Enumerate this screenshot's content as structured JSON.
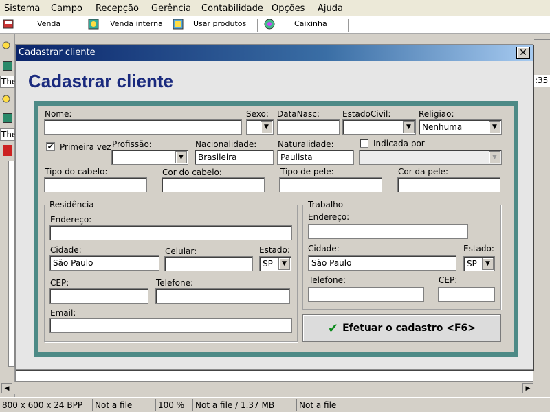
{
  "menubar": {
    "items": [
      "Sistema",
      "Campo",
      "Recepção",
      "Gerência",
      "Contabilidade",
      "Opções",
      "Ajuda"
    ]
  },
  "toolbar": {
    "buttons": [
      "Venda",
      "Venda interna",
      "Usar produtos",
      "Caixinha"
    ]
  },
  "background": {
    "fragments": [
      "The",
      "The",
      ":35"
    ]
  },
  "dialog": {
    "title": "Cadastrar cliente",
    "close_glyph": "✕",
    "heading": "Cadastrar cliente"
  },
  "form": {
    "nome_label": "Nome:",
    "nome_value": "",
    "sexo_label": "Sexo:",
    "sexo_value": "",
    "datanasc_label": "DataNasc:",
    "datanasc_value": "",
    "estadocivil_label": "EstadoCivil:",
    "estadocivil_value": "",
    "religiao_label": "Religiao:",
    "religiao_value": "Nenhuma",
    "primeira_vez_label": "Primeira vez",
    "primeira_vez_checked": "✔",
    "profissao_label": "Profissão:",
    "profissao_value": "",
    "nacionalidade_label": "Nacionalidade:",
    "nacionalidade_value": "Brasileira",
    "naturalidade_label": "Naturalidade:",
    "naturalidade_value": "Paulista",
    "indicada_label": "Indicada por",
    "indicada_value": "",
    "tipo_cabelo_label": "Tipo do cabelo:",
    "cor_cabelo_label": "Cor do cabelo:",
    "tipo_pele_label": "Tipo de pele:",
    "cor_pele_label": "Cor da pele:"
  },
  "residencia": {
    "group_label": "Residência",
    "endereco_label": "Endereço:",
    "endereco_value": "",
    "cidade_label": "Cidade:",
    "cidade_value": "São Paulo",
    "celular_label": "Celular:",
    "celular_value": "",
    "estado_label": "Estado:",
    "estado_value": "SP",
    "cep_label": "CEP:",
    "cep_value": "",
    "telefone_label": "Telefone:",
    "telefone_value": "",
    "email_label": "Email:",
    "email_value": ""
  },
  "trabalho": {
    "group_label": "Trabalho",
    "endereco_label": "Endereço:",
    "endereco_value": "",
    "cidade_label": "Cidade:",
    "cidade_value": "São Paulo",
    "estado_label": "Estado:",
    "estado_value": "SP",
    "telefone_label": "Telefone:",
    "telefone_value": "",
    "cep_label": "CEP:",
    "cep_value": ""
  },
  "submit": {
    "label": "Efetuar o cadastro <F6>",
    "icon": "✔"
  },
  "statusbar": {
    "resolution": "800 x 600 x 24 BPP",
    "file1": "Not a file",
    "zoom": "100 %",
    "file_size": "Not a file / 1.37 MB",
    "file2": "Not a file"
  },
  "colors": {
    "titlebar_start": "#0a246a",
    "heading": "#1a2a7e",
    "frame": "#4d8a86",
    "check_green": "#0a8a1a"
  }
}
